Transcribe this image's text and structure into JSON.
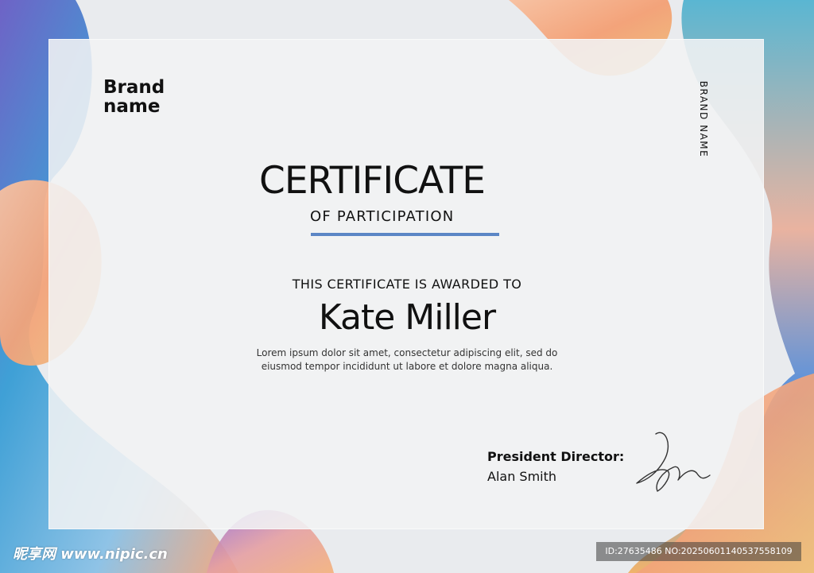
{
  "certificate": {
    "brand_left": [
      "Brand",
      "name"
    ],
    "brand_right": "BRAND NAME",
    "title": "CERTIFICATE",
    "subtitle": "OF PARTICIPATION",
    "awarded_to": "THIS CERTIFICATE IS AWARDED TO",
    "recipient": "Kate Miller",
    "body": "Lorem ipsum dolor sit amet, consectetur adipiscing elit, sed do eiusmod tempor incididunt ut labore et dolore magna aliqua.",
    "signatory_role": "President Director:",
    "signatory_name": "Alan Smith"
  },
  "watermark": {
    "site": "昵享网 www.nipic.cn",
    "id_text": "ID:27635486 NO:20250601140537558109"
  },
  "colors": {
    "accent_underline": "#5b86c5",
    "text": "#111111",
    "panel": "#f1f3f4"
  },
  "icons": {
    "signature": "handwritten-signature-icon"
  }
}
